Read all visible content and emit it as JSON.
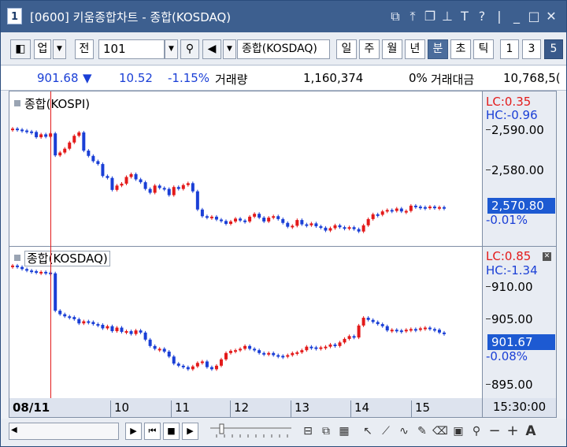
{
  "window": {
    "number": "1",
    "title": "[0600] 키움종합차트 - 종합(KOSDAQ)"
  },
  "toolbar": {
    "market": "업",
    "prev": "전",
    "code": "101",
    "name": "종합(KOSDAQ)",
    "periods": [
      "일",
      "주",
      "월",
      "년",
      "분",
      "초",
      "틱"
    ],
    "selected_period": "분",
    "intervals": [
      "1",
      "3",
      "5"
    ],
    "selected_interval": "5"
  },
  "quote": {
    "price": "901.68",
    "arrow": "▼",
    "change": "10.52",
    "change_pct": "-1.15%",
    "volume_label": "거래량",
    "volume": "1,160,374",
    "volume_pct": "0%",
    "amount_label": "거래대금",
    "amount": "10,768,5("
  },
  "panel1": {
    "label": "종합(KOSPI)",
    "lc": "LC:0.35",
    "hc": "HC:-0.96",
    "ticks": [
      "2,590.00",
      "2,580.00"
    ],
    "current": "2,570.80",
    "current_pct": "-0.01%"
  },
  "panel2": {
    "label": "종합(KOSDAQ)",
    "lc": "LC:0.85",
    "hc": "HC:-1.34",
    "ticks": [
      "910.00",
      "905.00",
      "895.00"
    ],
    "current": "901.67",
    "current_pct": "-0.08%"
  },
  "dateaxis": {
    "date": "08/11",
    "hours": [
      "10",
      "11",
      "12",
      "13",
      "14",
      "15"
    ],
    "time": "15:30:00"
  },
  "colors": {
    "up": "#e31a1a",
    "down": "#1a3fd6",
    "title_bar": "#3d5f8f",
    "badge": "#1d5ad2"
  },
  "chart_data": [
    {
      "type": "candlestick",
      "title": "종합(KOSPI)",
      "ylabel": "",
      "ylim": [
        2566,
        2594
      ],
      "x_hours": [
        "10",
        "11",
        "12",
        "13",
        "14",
        "15"
      ],
      "close": [
        2589.2,
        2589.0,
        2588.8,
        2588.6,
        2588.5,
        2587.4,
        2588.0,
        2587.5,
        2588.2,
        2583.6,
        2584.2,
        2585.0,
        2586.3,
        2587.7,
        2588.4,
        2584.6,
        2583.5,
        2582.4,
        2581.8,
        2579.3,
        2578.9,
        2576.4,
        2577.3,
        2577.7,
        2579.1,
        2579.7,
        2578.6,
        2578.0,
        2576.6,
        2575.8,
        2577.3,
        2576.8,
        2576.6,
        2575.3,
        2577.0,
        2576.6,
        2577.4,
        2577.8,
        2576.1,
        2572.3,
        2570.9,
        2570.7,
        2570.8,
        2570.2,
        2569.9,
        2569.3,
        2569.8,
        2570.4,
        2570.0,
        2569.8,
        2570.8,
        2571.4,
        2570.6,
        2569.8,
        2570.6,
        2570.9,
        2570.3,
        2569.5,
        2568.7,
        2568.9,
        2570.1,
        2569.2,
        2569.0,
        2569.4,
        2568.8,
        2568.5,
        2567.9,
        2568.4,
        2569.0,
        2568.6,
        2568.4,
        2568.6,
        2568.2,
        2567.7,
        2569.0,
        2570.3,
        2571.3,
        2571.2,
        2571.9,
        2572.2,
        2572.0,
        2572.5,
        2571.9,
        2572.0,
        2573.1,
        2572.9,
        2572.8,
        2572.6,
        2572.9,
        2572.6,
        2572.8,
        2572.5
      ]
    },
    {
      "type": "candlestick",
      "title": "종합(KOSDAQ)",
      "ylabel": "",
      "ylim": [
        893.5,
        912.5
      ],
      "x_hours": [
        "10",
        "11",
        "12",
        "13",
        "14",
        "15"
      ],
      "close": [
        911.4,
        911.2,
        910.9,
        910.7,
        910.6,
        910.5,
        910.5,
        910.4,
        910.3,
        905.0,
        904.5,
        904.2,
        904.1,
        903.8,
        903.2,
        903.5,
        903.4,
        903.1,
        903.0,
        902.5,
        902.8,
        902.1,
        902.6,
        902.0,
        902.1,
        901.7,
        902.2,
        901.9,
        900.9,
        900.0,
        899.6,
        899.6,
        899.2,
        898.5,
        897.5,
        897.2,
        897.0,
        896.7,
        897.1,
        897.6,
        897.8,
        897.0,
        896.7,
        897.2,
        898.1,
        899.0,
        899.3,
        899.4,
        899.6,
        900.0,
        899.6,
        899.4,
        899.0,
        898.9,
        899.0,
        898.7,
        898.6,
        898.5,
        898.7,
        899.0,
        899.1,
        899.4,
        899.9,
        899.8,
        899.6,
        899.8,
        899.9,
        900.2,
        900.0,
        900.5,
        901.0,
        901.4,
        901.2,
        902.9,
        904.0,
        903.7,
        903.4,
        903.1,
        902.8,
        902.2,
        902.3,
        902.2,
        902.1,
        902.3,
        902.4,
        902.3,
        902.5,
        902.6,
        902.4,
        902.3,
        901.9,
        901.7
      ]
    }
  ]
}
